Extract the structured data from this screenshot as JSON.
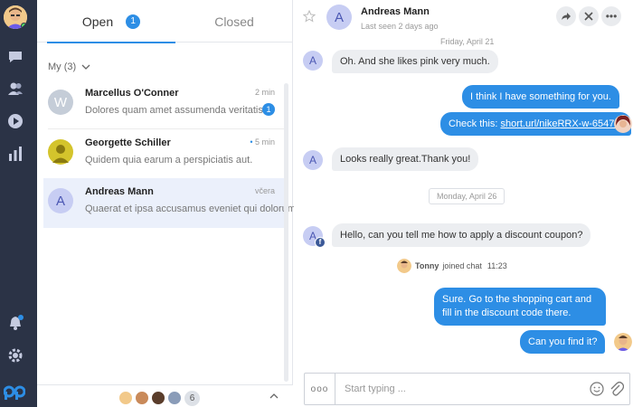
{
  "colors": {
    "accent": "#2d8ee5",
    "rail": "#2b3346",
    "active_row": "#ebf0fb"
  },
  "rail": {
    "items": [
      "chat-icon",
      "contacts-icon",
      "play-icon",
      "reports-icon"
    ],
    "bottom": [
      "bell-icon",
      "gear-icon",
      "logo-icon"
    ]
  },
  "tabs": {
    "open_label": "Open",
    "open_count": "1",
    "closed_label": "Closed"
  },
  "filter": {
    "label": "My (3)"
  },
  "conversations": [
    {
      "avatar": "W",
      "name": "Marcellus O'Conner",
      "preview": "Dolores quam amet assumenda veritatis",
      "time": "2 min",
      "unread": "1"
    },
    {
      "avatar": "",
      "name": "Georgette Schiller",
      "preview": "Quidem quia earum a perspiciatis aut.",
      "time": "5 min"
    },
    {
      "avatar": "A",
      "name": "Andreas Mann",
      "preview": "Quaerat et ipsa accusamus eveniet qui dolorum",
      "time": "včera"
    }
  ],
  "agents_bar": {
    "extra_count": "6"
  },
  "chat": {
    "header": {
      "avatar": "A",
      "name": "Andreas Mann",
      "seen": "Last seen 2 days ago"
    },
    "day1": "Friday, April 21",
    "day2": "Monday, April 26",
    "messages": {
      "m1": "Oh. And she likes pink very much.",
      "m2": "I think I have something for you.",
      "m3_prefix": "Check this: ",
      "m3_link": "short.url/nikeRRX-w-6547-k",
      "m4": "Looks really great.Thank you!",
      "m5": "Hello, can you tell me how to apply a discount coupon?",
      "m6": "Sure. Go to the shopping cart and fill in the discount code there.",
      "m7": "Can you find it?"
    },
    "system": {
      "agent": "Tonny",
      "text": "joined chat",
      "time": "11:23"
    },
    "customer_avatar": "A"
  },
  "composer": {
    "placeholder": "Start typing ...",
    "more": "ooo"
  }
}
